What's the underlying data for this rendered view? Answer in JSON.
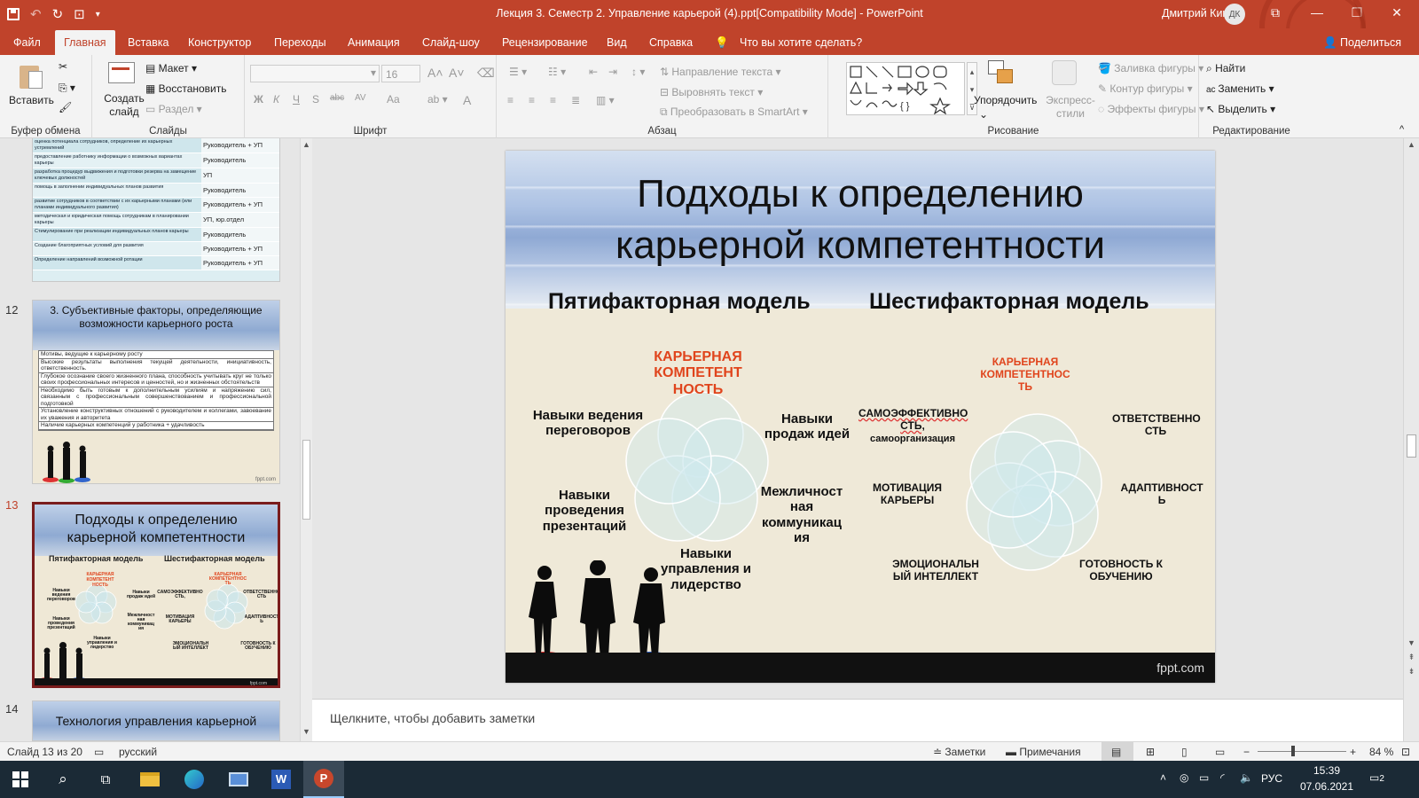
{
  "window": {
    "title": "Лекция 3. Семестр 2. Управление карьерой (4).ppt[Compatibility Mode]  -  PowerPoint",
    "user": "Дмитрий Кикоть",
    "user_initials": "ДК"
  },
  "tabs": [
    "Файл",
    "Главная",
    "Вставка",
    "Конструктор",
    "Переходы",
    "Анимация",
    "Слайд-шоу",
    "Рецензирование",
    "Вид",
    "Справка"
  ],
  "tell_me": "Что вы хотите сделать?",
  "share": "Поделиться",
  "ribbon": {
    "clipboard": {
      "paste": "Вставить",
      "label": "Буфер обмена"
    },
    "slides": {
      "new_slide": "Создать слайд",
      "layout": "Макет",
      "reset": "Восстановить",
      "section": "Раздел",
      "label": "Слайды"
    },
    "font": {
      "size": "16",
      "label": "Шрифт",
      "buttons": [
        "Ж",
        "К",
        "Ч",
        "S",
        "abc",
        "AV",
        "Aa",
        "A"
      ]
    },
    "paragraph": {
      "direction": "Направление текста",
      "align": "Выровнять текст",
      "smartart": "Преобразовать в SmartArt",
      "label": "Абзац"
    },
    "drawing": {
      "arrange": "Упорядочить",
      "quick_styles": "Экспресс-стили",
      "fill": "Заливка фигуры",
      "outline": "Контур фигуры",
      "effects": "Эффекты фигуры",
      "label": "Рисование"
    },
    "editing": {
      "find": "Найти",
      "replace": "Заменить",
      "select": "Выделить",
      "label": "Редактирование"
    }
  },
  "thumbnails": {
    "t11_rows": [
      [
        "оценка потенциала сотрудников, определение их карьерных устремлений",
        "Руководитель + УП"
      ],
      [
        "предоставление работнику информации о возможных вариантах карьеры",
        "Руководитель"
      ],
      [
        "разработка процедур выдвижения и подготовки резерва на замещение ключевых должностей",
        "УП"
      ],
      [
        "помощь в заполнении индивидуальных планов развития",
        "Руководитель"
      ],
      [
        "развитие сотрудников в соответствии с их карьерными планами (или планами индивидуального развития)",
        "Руководитель + УП"
      ],
      [
        "методическая и юридическая помощь сотрудникам в планировании карьеры",
        "УП, юр.отдел"
      ],
      [
        "Стимулирование при реализации индивидуальных планов карьеры",
        "Руководитель"
      ],
      [
        "Создание благоприятных условий для развития",
        "Руководитель + УП"
      ],
      [
        "Определение направлений возможной ротации",
        "Руководитель + УП"
      ]
    ],
    "slide12": {
      "num": "12",
      "title": "3. Субъективные факторы, определяющие возможности карьерного роста",
      "rows": [
        "Мотивы, ведущие к карьерному росту",
        "Высокие результаты выполнения текущей деятельности, инициативность, ответственность.",
        "Глубокое осознание своего жизненного плана, способность учитывать круг не только своих профессиональных интересов и ценностей, но и жизненных обстоятельств",
        "Необходимо быть готовым к дополнительным усилиям и напряжению сил, связанным с профессиональным совершенствованием и профессиональной подготовкой",
        "Установление конструктивных отношений с руководителем и коллегами, завоевание их уважения и авторитета",
        "Наличие карьерных компетенций у работника + удачливость"
      ]
    },
    "slide13": {
      "num": "13",
      "title": "Подходы к определению карьерной компетентности",
      "left": "Пятифакторная модель",
      "right": "Шестифакторная модель"
    },
    "slide14": {
      "num": "14",
      "title": "Технология управления карьерной"
    }
  },
  "slide": {
    "title": "Подходы к определению карьерной компетентности",
    "left_model": "Пятифакторная модель",
    "right_model": "Шестифакторная модель",
    "left_center": "КАРЬЕРНАЯ КОМПЕТЕНТ НОСТЬ",
    "left_labels": [
      "Навыки ведения переговоров",
      "Навыки продаж идей",
      "Навыки проведения презентаций",
      "Межличност ная коммуникац ия",
      "Навыки управления и лидерство"
    ],
    "right_center": "КАРЬЕРНАЯ КОМПЕТЕНТНОС ТЬ",
    "right_labels": {
      "self_eff": "САМОЭФФЕКТИВНО СТЬ,",
      "self_org": "самоорганизация",
      "resp": "ОТВЕТСТВЕННО СТЬ",
      "motiv": "МОТИВАЦИЯ КАРЬЕРЫ",
      "adapt": "АДАПТИВНОСТ Ь",
      "eq": "ЭМОЦИОНАЛЬН ЫЙ ИНТЕЛЛЕКТ",
      "learn": "ГОТОВНОСТЬ К ОБУЧЕНИЮ"
    },
    "footer": "fppt.com"
  },
  "notes_placeholder": "Щелкните, чтобы добавить заметки",
  "status": {
    "slide": "Слайд 13 из 20",
    "lang": "русский",
    "notes": "Заметки",
    "comments": "Примечания",
    "zoom": "84 %"
  },
  "taskbar": {
    "lang": "РУС",
    "time": "15:39",
    "date": "07.06.2021",
    "notif": "2"
  },
  "colors": {
    "accent": "#c0432b",
    "orange_text": "#e0441c"
  }
}
